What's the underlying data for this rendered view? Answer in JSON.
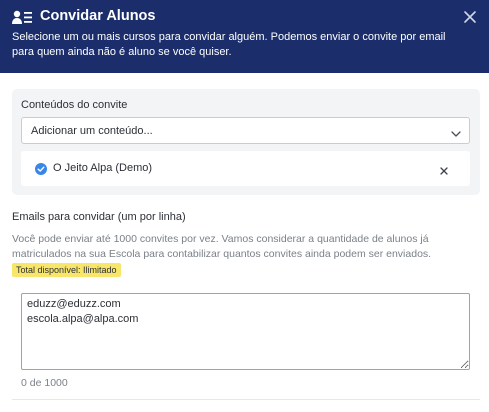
{
  "dialog": {
    "title": "Convidar Alunos",
    "description": "Selecione um ou mais cursos para convidar alguém. Podemos enviar o convite por email para quem ainda não é aluno se você quiser.",
    "header_icon": "user-list-icon",
    "close_icon": "close-icon"
  },
  "contents": {
    "label": "Conteúdos do convite",
    "select_placeholder": "Adicionar um conteúdo...",
    "selected_items": [
      {
        "label": "O Jeito Alpa (Demo)",
        "icon": "check-circle-icon",
        "remove_icon": "close-icon"
      }
    ]
  },
  "emails": {
    "label": "Emails para convidar (um por linha)",
    "help_text": "Você pode enviar até 1000 convites por vez. Vamos considerar a quantidade de alunos já matriculados na sua Escola para contabilizar quantos convites ainda podem ser enviados.",
    "badge": "Total disponível: Ilimitado",
    "value": "eduzz@eduzz.com\nescola.alpa@alpa.com",
    "counter": "0 de 1000"
  },
  "colors": {
    "header_bg": "#1b2e6b",
    "check_blue": "#3a86e8",
    "badge_yellow": "#f7e66a",
    "panel_bg": "#f3f4f6"
  }
}
